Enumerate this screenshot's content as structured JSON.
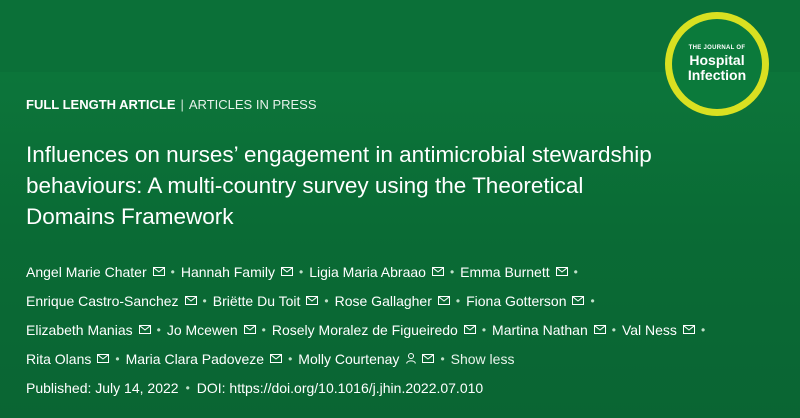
{
  "journal": {
    "logo_small": "THE JOURNAL OF",
    "logo_line1": "Hospital",
    "logo_line2": "Infection"
  },
  "article": {
    "type": "FULL LENGTH ARTICLE",
    "separator": "|",
    "status": "ARTICLES IN PRESS",
    "title": "Influences on nurses’ engagement in antimicrobial stewardship behaviours: A multi-country survey using the Theoretical Domains Framework"
  },
  "authors": {
    "line1": [
      "Angel Marie Chater",
      "Hannah Family",
      "Ligia Maria Abraao",
      "Emma Burnett"
    ],
    "line2": [
      "Enrique Castro-Sanchez",
      "Briëtte Du Toit",
      "Rose Gallagher",
      "Fiona Gotterson"
    ],
    "line3": [
      "Elizabeth Manias",
      "Jo Mcewen",
      "Rosely Moralez de Figueiredo",
      "Martina Nathan",
      "Val Ness"
    ],
    "line4": [
      "Rita Olans",
      "Maria Clara Padoveze",
      "Molly Courtenay"
    ],
    "show_less": "Show less"
  },
  "publication": {
    "published": "Published: July 14, 2022",
    "doi": "DOI: https://doi.org/10.1016/j.jhin.2022.07.010"
  },
  "icons": [
    "mail-icon",
    "user-icon",
    "journal-logo"
  ]
}
